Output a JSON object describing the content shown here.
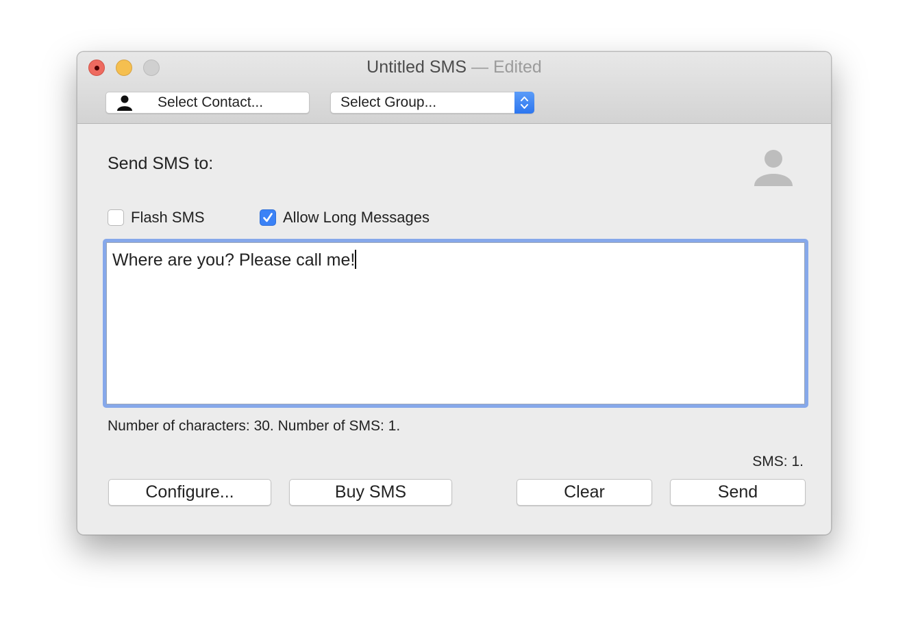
{
  "window": {
    "title": "Untitled SMS",
    "title_suffix": "— Edited",
    "traffic_lights": {
      "close": "close-window",
      "minimize": "minimize-window",
      "zoom": "zoom-window"
    }
  },
  "toolbar": {
    "select_contact_label": "Select Contact...",
    "select_contact_icon": "person-icon",
    "select_group_value": "Select Group...",
    "select_group_icon": "up-down-chevron-icon"
  },
  "recipient": {
    "label": "Send SMS to:",
    "avatar_icon": "person-placeholder-icon"
  },
  "options": {
    "flash_sms": {
      "label": "Flash SMS",
      "checked": false
    },
    "allow_long": {
      "label": "Allow Long Messages",
      "checked": true
    }
  },
  "message": {
    "text": "Where are you? Please call me!"
  },
  "status": {
    "counts": "Number of characters: 30. Number of SMS: 1.",
    "sms_balance": "SMS: 1."
  },
  "buttons": {
    "configure": "Configure...",
    "buy_sms": "Buy SMS",
    "clear": "Clear",
    "send": "Send"
  },
  "colors": {
    "accent": "#3b82f6",
    "focus_ring": "#86a8ea",
    "close": "#ee6a5f",
    "minimize": "#f5bf4f"
  }
}
